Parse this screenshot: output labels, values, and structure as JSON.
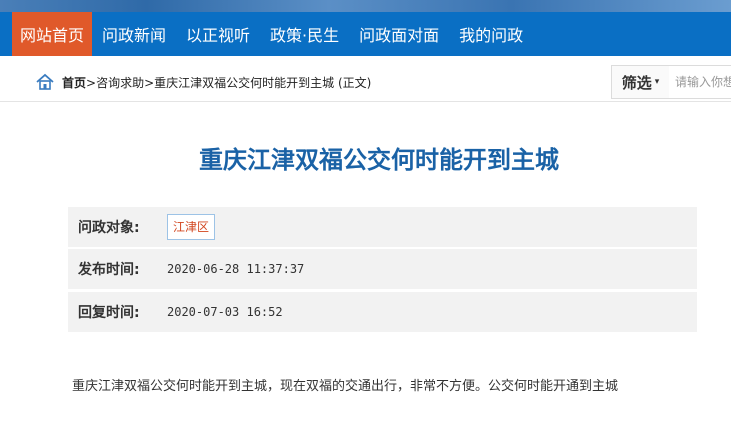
{
  "nav": {
    "items": [
      {
        "label": "网站首页",
        "active": true
      },
      {
        "label": "问政新闻"
      },
      {
        "label": "以正视听"
      },
      {
        "label": "政策·民生"
      },
      {
        "label": "问政面对面"
      },
      {
        "label": "我的问政"
      }
    ]
  },
  "breadcrumb": {
    "home": "首页",
    "path": ">咨询求助>重庆江津双福公交何时能开到主城 (正文)"
  },
  "filter": {
    "label": "筛选",
    "caret": "▾"
  },
  "search": {
    "placeholder": "请输入你想"
  },
  "article": {
    "title": "重庆江津双福公交何时能开到主城",
    "target_label": "问政对象:",
    "target_value": "江津区",
    "published_label": "发布时间:",
    "published_value": "2020-06-28 11:37:37",
    "replied_label": "回复时间:",
    "replied_value": "2020-07-03 16:52",
    "body": "重庆江津双福公交何时能开到主城，现在双福的交通出行，非常不方便。公交何时能开通到主城"
  },
  "colors": {
    "nav_bg": "#0a6fc4",
    "nav_active": "#e0592a",
    "title": "#1a62a6",
    "tag_text": "#d2461f"
  }
}
